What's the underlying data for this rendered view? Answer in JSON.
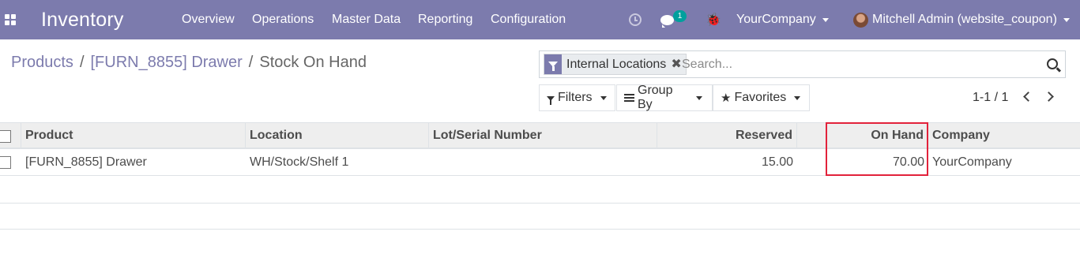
{
  "navbar": {
    "app_title": "Inventory",
    "menu": [
      "Overview",
      "Operations",
      "Master Data",
      "Reporting",
      "Configuration"
    ],
    "chat_badge": "1",
    "company": "YourCompany",
    "user": "Mitchell Admin (website_coupon)"
  },
  "breadcrumb": {
    "items": [
      "Products",
      "[FURN_8855] Drawer"
    ],
    "separator": "/",
    "current": "Stock On Hand"
  },
  "search": {
    "facet": "Internal Locations",
    "facet_remove": "✖",
    "placeholder": "Search..."
  },
  "toolbar": {
    "filters": "Filters",
    "group_by": "Group By",
    "favorites": "Favorites"
  },
  "pager": {
    "value": "1-1 / 1"
  },
  "table": {
    "columns": [
      "Product",
      "Location",
      "Lot/Serial Number",
      "Reserved",
      "On Hand",
      "Company"
    ],
    "rows": [
      {
        "product": "[FURN_8855] Drawer",
        "location": "WH/Stock/Shelf 1",
        "lot": "",
        "reserved": "15.00",
        "on_hand": "70.00",
        "company": "YourCompany"
      }
    ]
  },
  "colors": {
    "navbar": "#7c7bad",
    "link": "#7c7bad",
    "badge": "#00a09d",
    "highlight": "#e2223b"
  },
  "icons": [
    "apps-icon",
    "clock-icon",
    "chat-icon",
    "bug-icon",
    "caret-down-icon",
    "avatar",
    "filter-icon",
    "close-icon",
    "search-icon",
    "bars-icon",
    "star-icon",
    "chevron-left-icon",
    "chevron-right-icon",
    "checkbox"
  ]
}
